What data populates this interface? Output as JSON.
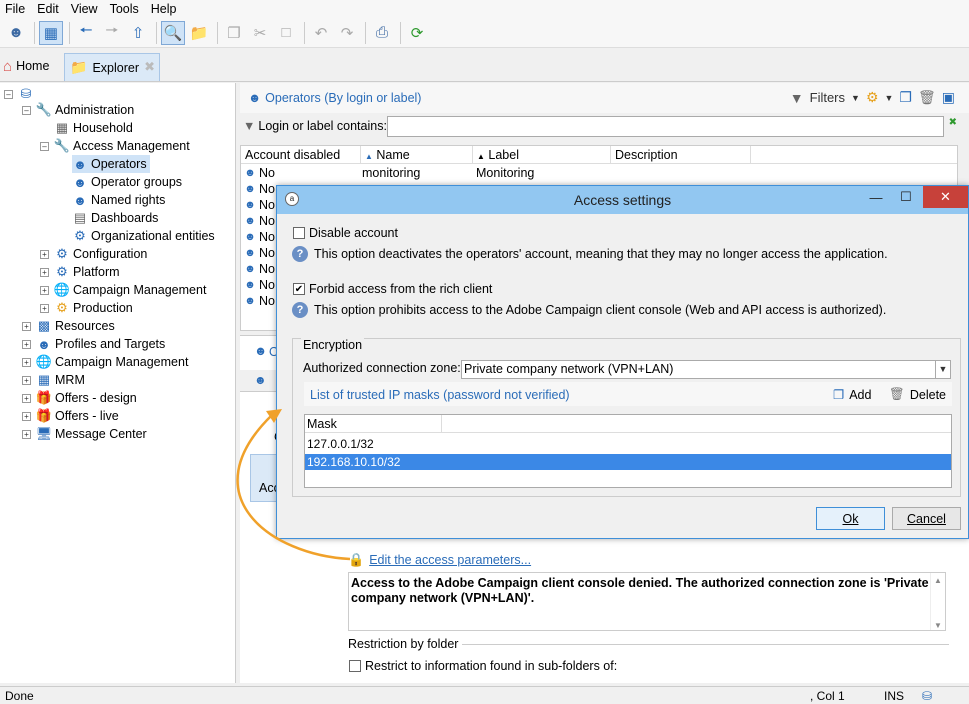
{
  "menu": [
    "File",
    "Edit",
    "View",
    "Tools",
    "Help"
  ],
  "tabs": {
    "home": "Home",
    "explorer": "Explorer"
  },
  "tree": {
    "root_label": "",
    "items": [
      {
        "label": "Administration",
        "icon": "wrench-icon"
      },
      {
        "label": "Household",
        "icon": "table-icon"
      },
      {
        "label": "Access Management",
        "icon": "wrench-icon"
      },
      {
        "label": "Operators",
        "icon": "operator-icon"
      },
      {
        "label": "Operator groups",
        "icon": "group-icon"
      },
      {
        "label": "Named rights",
        "icon": "rights-icon"
      },
      {
        "label": "Dashboards",
        "icon": "dashboard-icon"
      },
      {
        "label": "Organizational entities",
        "icon": "entity-icon"
      },
      {
        "label": "Configuration",
        "icon": "gear-icon"
      },
      {
        "label": "Platform",
        "icon": "gear-icon"
      },
      {
        "label": "Campaign Management",
        "icon": "globe-icon"
      },
      {
        "label": "Production",
        "icon": "gear-icon"
      },
      {
        "label": "Resources",
        "icon": "resources-icon"
      },
      {
        "label": "Profiles and Targets",
        "icon": "people-icon"
      },
      {
        "label": "Campaign Management",
        "icon": "globe-icon"
      },
      {
        "label": "MRM",
        "icon": "grid-icon"
      },
      {
        "label": "Offers - design",
        "icon": "gift-icon"
      },
      {
        "label": "Offers - live",
        "icon": "gift-icon"
      },
      {
        "label": "Message Center",
        "icon": "monitor-icon"
      }
    ]
  },
  "panel": {
    "title": "Operators (By login or label)",
    "filters_label": "Filters",
    "filter_label": "Login or label contains:",
    "columns": [
      "Account disabled",
      "Name",
      "Label",
      "Description"
    ],
    "first_row": {
      "disabled": "No",
      "name": "monitoring",
      "label": "Monitoring"
    },
    "row_prefix": "No"
  },
  "dialog": {
    "title": "Access settings",
    "disable_account": "Disable account",
    "disable_desc": "This option deactivates the operators' account, meaning that they may no longer access the application.",
    "forbid_access": "Forbid access from the rich client",
    "forbid_desc": "This option prohibits access to the Adobe Campaign client console (Web and API access is authorized).",
    "encryption_label": "Encryption",
    "zone_label": "Authorized connection zone:",
    "zone_value": "Private company network (VPN+LAN)",
    "trusted_link": "List of trusted IP masks (password not verified)",
    "add_label": "Add",
    "delete_label": "Delete",
    "mask_header": "Mask",
    "masks": [
      "127.0.0.1/32",
      "192.168.10.10/32"
    ],
    "ok_label": "Ok",
    "cancel_label": "Cancel",
    "disable_checked": false,
    "forbid_checked": true
  },
  "details": {
    "edit_link": "Edit the access parameters...",
    "message": "Access to the Adobe Campaign client console denied. The authorized connection zone is 'Private company network (VPN+LAN)'.",
    "restriction_label": "Restriction by folder",
    "restrict_sub": "Restrict to information found in sub-folders of:",
    "partial_o": "O",
    "partial_acc": "Acc",
    "partial_c": "C"
  },
  "status": {
    "left": "Done",
    "col": ", Col 1",
    "ins": "INS"
  },
  "colors": {
    "accent": "#2a6cb8",
    "dialog_title_bg": "#92c7f1",
    "close_bg": "#c7413a",
    "selected_row": "#3b88e6",
    "arrow": "#f0a12a"
  }
}
